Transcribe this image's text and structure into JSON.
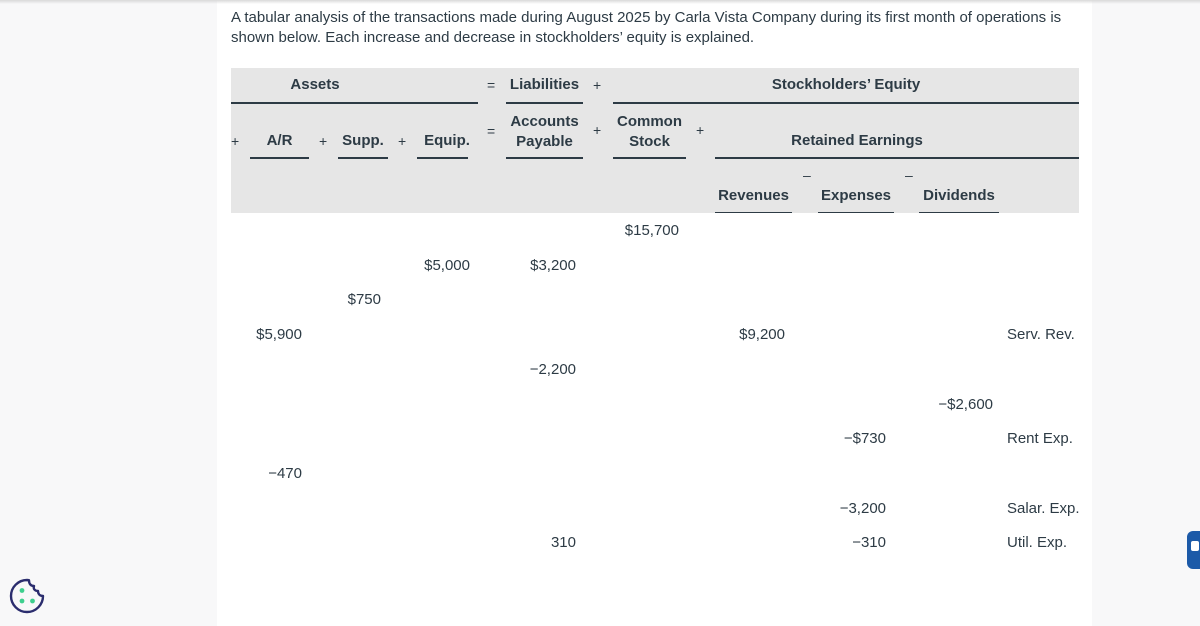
{
  "intro_text": "A tabular analysis of the transactions made during August 2025 by Carla Vista Company during its first month of operations is shown below. Each increase and decrease in stockholders’ equity is explained.",
  "header": {
    "assets": "Assets",
    "equals": "=",
    "liabilities": "Liabilities",
    "plus": "+",
    "minus": "–",
    "stockholders_equity": "Stockholders’ Equity",
    "retained_earnings": "Retained Earnings",
    "columns": {
      "ar": "A/R",
      "supplies": "Supp.",
      "equipment": "Equip.",
      "accounts_payable_1": "Accounts",
      "accounts_payable_2": "Payable",
      "common_stock_1": "Common",
      "common_stock_2": "Stock",
      "revenues": "Revenues",
      "expenses": "Expenses",
      "dividends": "Dividends"
    }
  },
  "rows": [
    {
      "common_stock": "$15,700"
    },
    {
      "equipment": "$5,000",
      "accounts_payable": "$3,200"
    },
    {
      "supplies": "$750"
    },
    {
      "ar": "$5,900",
      "revenues": "$9,200",
      "note": "Serv. Rev."
    },
    {
      "accounts_payable": "−2,200"
    },
    {
      "dividends": "−$2,600"
    },
    {
      "expenses": "−$730",
      "note": "Rent Exp."
    },
    {
      "ar": "−470"
    },
    {
      "expenses": "−3,200",
      "note": "Salar. Exp."
    },
    {
      "accounts_payable": "310",
      "expenses": "−310",
      "note": "Util. Exp."
    }
  ],
  "icons": {
    "cookie": "cookie-settings-icon",
    "chat": "chat-feedback-icon"
  },
  "colors": {
    "header_bg": "#e6e6e6",
    "text": "#2d3b45",
    "cookie_outline": "#2b2d6e",
    "cookie_dots": "#3ecf8e",
    "chat_button": "#1c5aa8"
  }
}
